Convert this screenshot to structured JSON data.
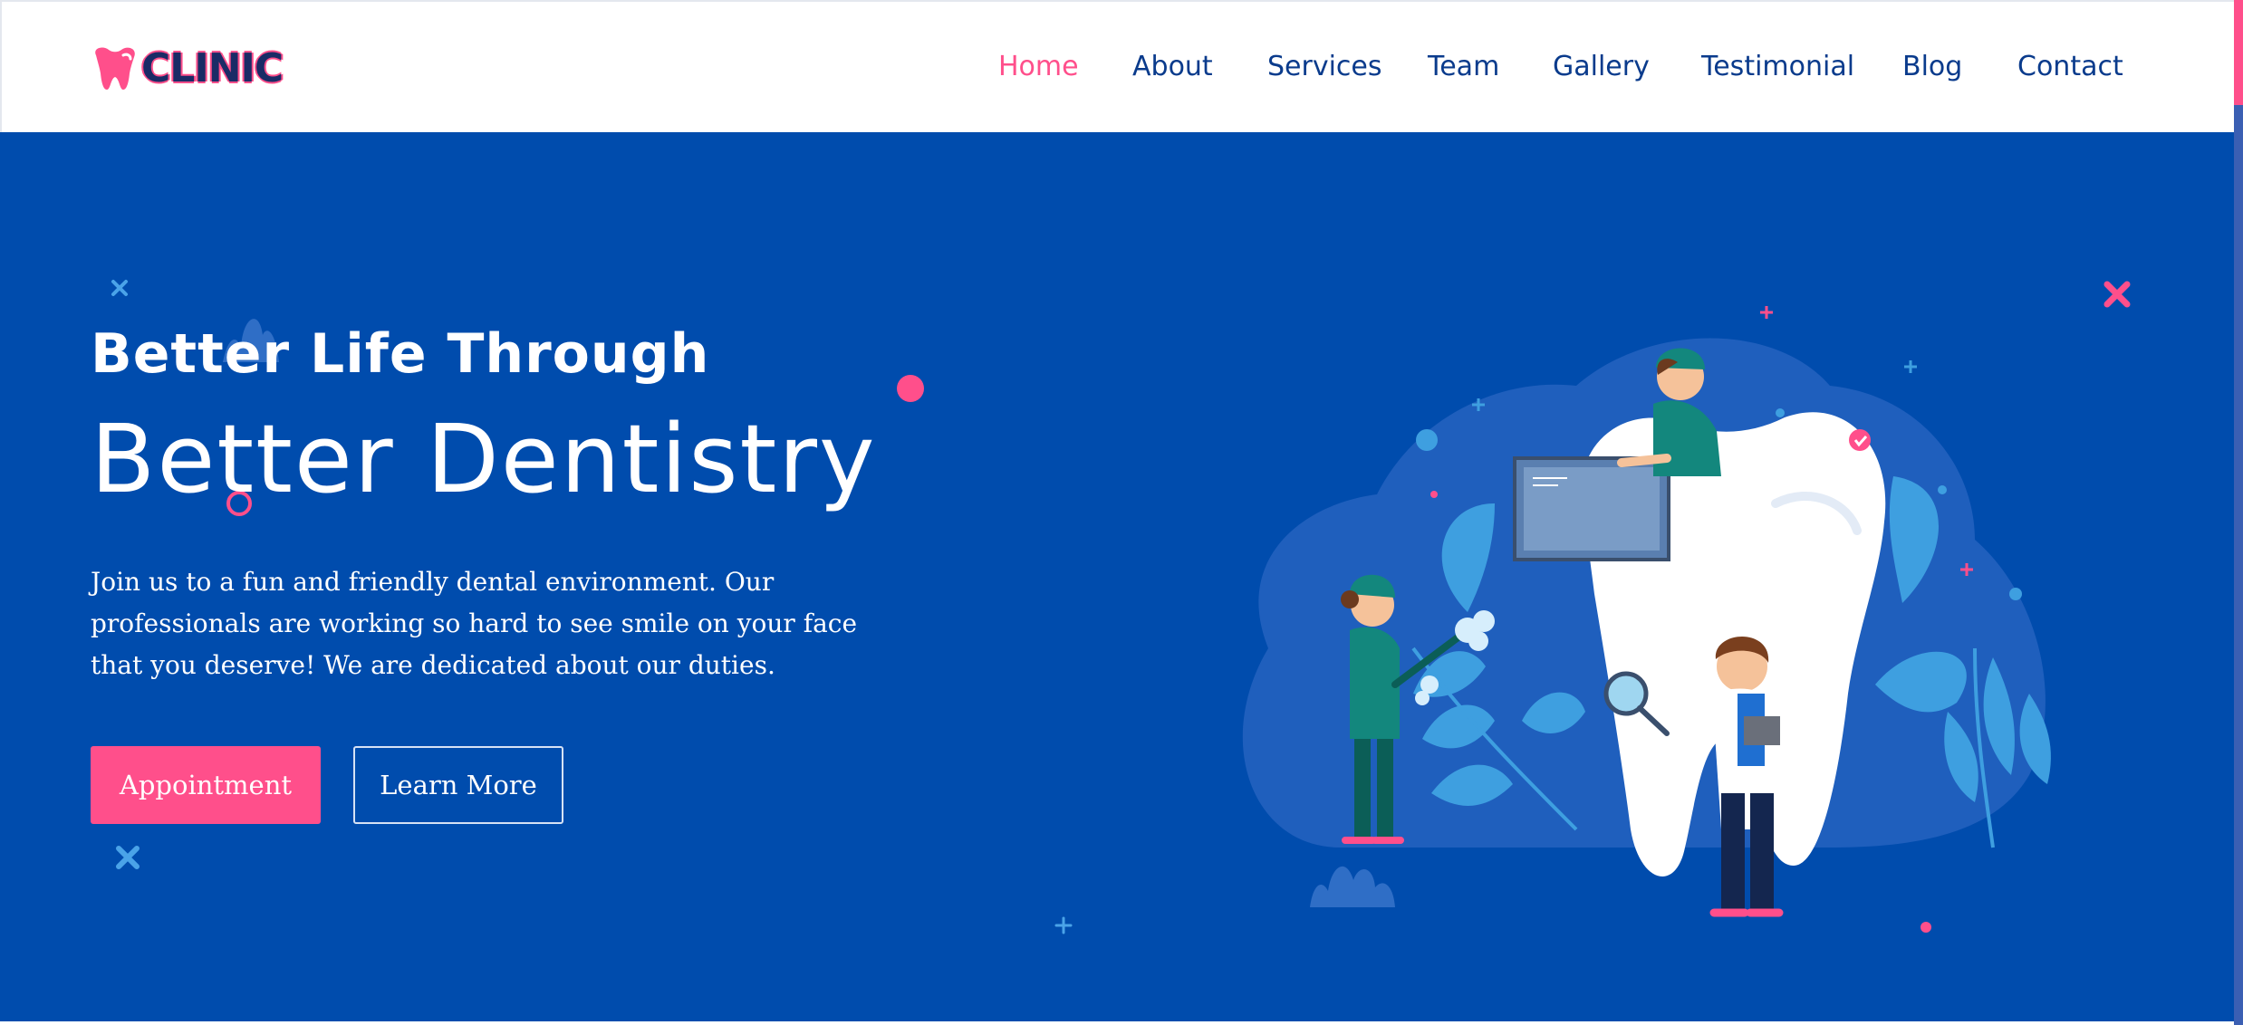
{
  "brand": {
    "name": "CLINIC",
    "logo_icon": "tooth-icon",
    "colors": {
      "primary": "#ff4f8b",
      "navy": "#0a3b8c",
      "hero_bg": "#004cad"
    }
  },
  "nav": {
    "items": [
      {
        "label": "Home",
        "active": true
      },
      {
        "label": "About"
      },
      {
        "label": "Services"
      },
      {
        "label": "Team"
      },
      {
        "label": "Gallery"
      },
      {
        "label": "Testimonial"
      },
      {
        "label": "Blog"
      },
      {
        "label": "Contact"
      }
    ]
  },
  "hero": {
    "subtitle": "Better Life Through",
    "title": "Better Dentistry",
    "description": "Join us to a fun and friendly dental environment. Our professionals are working so hard to see smile on your face that you deserve! We are dedicated about our duties.",
    "primary_button": "Appointment",
    "secondary_button": "Learn More",
    "illustration": "dentist-team-illustration"
  }
}
